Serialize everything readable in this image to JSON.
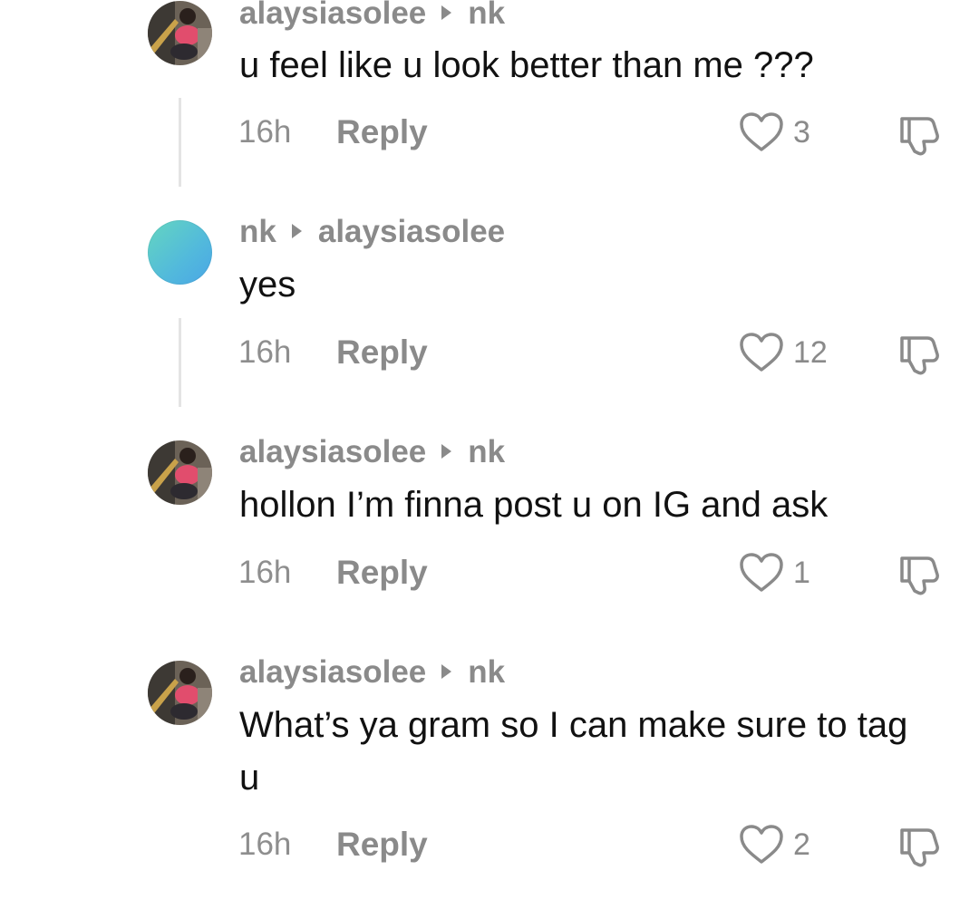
{
  "comments": [
    {
      "author": "alaysiasolee",
      "reply_to": "nk",
      "text": "u feel like u look better than me ???",
      "time": "16h",
      "reply_label": "Reply",
      "likes": "3",
      "avatar": "photo"
    },
    {
      "author": "nk",
      "reply_to": "alaysiasolee",
      "text": "yes",
      "time": "16h",
      "reply_label": "Reply",
      "likes": "12",
      "avatar": "gradient"
    },
    {
      "author": "alaysiasolee",
      "reply_to": "nk",
      "text": "hollon I’m finna post u on IG and ask",
      "time": "16h",
      "reply_label": "Reply",
      "likes": "1",
      "avatar": "photo"
    },
    {
      "author": "alaysiasolee",
      "reply_to": "nk",
      "text": "What’s ya gram so I can make sure to tag u",
      "time": "16h",
      "reply_label": "Reply",
      "likes": "2",
      "avatar": "photo"
    }
  ],
  "icons": {
    "like": "heart-outline-icon",
    "dislike": "thumbs-down-icon",
    "separator": "triangle-right-icon"
  },
  "colors": {
    "meta_gray": "#8a8a8a",
    "text": "#111111",
    "avatar_gradient_start": "#64d6c0",
    "avatar_gradient_end": "#4aa6e6"
  }
}
